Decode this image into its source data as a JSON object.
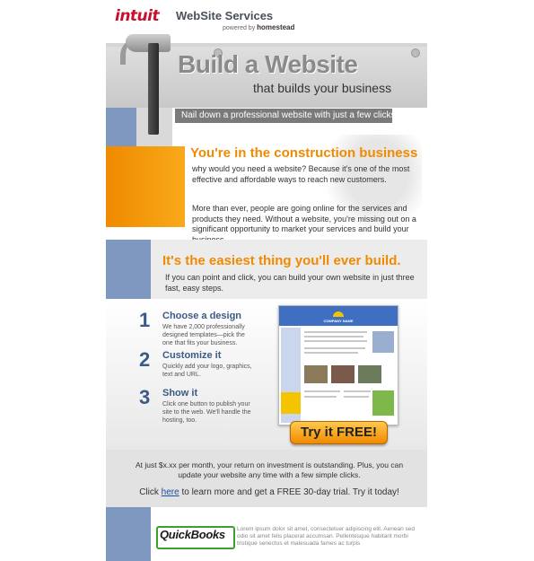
{
  "header": {
    "brand": "intuit",
    "product": "WebSite Services",
    "powered_prefix": "powered by",
    "powered_brand": "homestead"
  },
  "hero": {
    "title": "Build a Website",
    "subtitle": "that builds your business",
    "tagline": "Nail down a professional website with just a few clicks"
  },
  "construction": {
    "heading": "You're in the construction business",
    "p1": "why would you need a website? Because it's one of the most effective and affordable ways to reach new customers.",
    "p2": "More than ever, people are going online for the services and products they need. Without a website, you're missing out on a significant opportunity to market your services and build your business."
  },
  "easiest": {
    "heading": "It's the easiest thing you'll ever build.",
    "text": "If you can point and click, you can build your own website in just three fast, easy steps."
  },
  "steps": [
    {
      "num": "1",
      "title": "Choose a design",
      "desc": "We have 2,000 professionally designed templates—pick the one that fits your business."
    },
    {
      "num": "2",
      "title": "Customize it",
      "desc": "Quickly add your logo, graphics, text and URL."
    },
    {
      "num": "3",
      "title": "Show it",
      "desc": "Click one button to publish your site to the web. We'll handle the hosting, too."
    }
  ],
  "preview": {
    "company_name": "COMPANY NAME"
  },
  "cta": {
    "button": "Try it FREE!"
  },
  "info": {
    "price_text": "At just $x.xx per month, your return on investment is outstanding. Plus, you can update your website any time with a few simple clicks.",
    "click_prefix": "Click ",
    "click_link": "here",
    "click_suffix": " to learn more and get a FREE 30-day trial. Try it today!"
  },
  "footer": {
    "logo": "QuickBooks",
    "lorem": "Lorem ipsum dolor sit amet, consectetuer adipiscing elit. Aenean sed odio sit amet felis placerat accumsan. Pellentesque habitant morbi tristique senectus et malesuada fames ac turpis"
  },
  "colors": {
    "orange": "#f08a00",
    "blue": "#3b5a86",
    "strip_blue": "#7f98bf"
  }
}
